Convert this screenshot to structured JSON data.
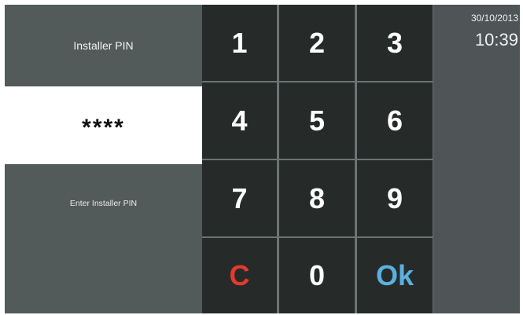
{
  "header": {
    "title": "Installer PIN"
  },
  "pin": {
    "masked_value": "****"
  },
  "hint": {
    "text": "Enter Installer PIN"
  },
  "keypad": {
    "keys": [
      "1",
      "2",
      "3",
      "4",
      "5",
      "6",
      "7",
      "8",
      "9",
      "C",
      "0",
      "Ok"
    ]
  },
  "clock": {
    "date": "30/10/2013",
    "time": "10:39"
  },
  "colors": {
    "clear_key": "#e23a2e",
    "ok_key": "#5cb0df",
    "key_background": "#262b2a",
    "panel_background": "#535a5a"
  }
}
